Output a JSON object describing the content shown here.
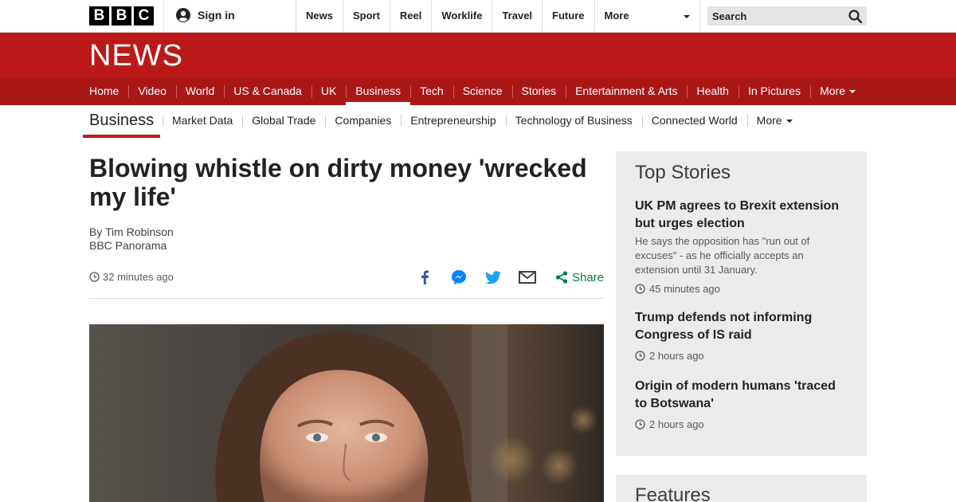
{
  "topbar": {
    "logo_letters": [
      "B",
      "B",
      "C"
    ],
    "signin_label": "Sign in",
    "nav": [
      "News",
      "Sport",
      "Reel",
      "Worklife",
      "Travel",
      "Future"
    ],
    "more_label": "More",
    "search_placeholder": "Search"
  },
  "masthead": {
    "wordmark": "NEWS",
    "sections": [
      {
        "label": "Home"
      },
      {
        "label": "Video"
      },
      {
        "label": "World"
      },
      {
        "label": "US & Canada"
      },
      {
        "label": "UK"
      },
      {
        "label": "Business",
        "active": true
      },
      {
        "label": "Tech"
      },
      {
        "label": "Science"
      },
      {
        "label": "Stories"
      },
      {
        "label": "Entertainment & Arts"
      },
      {
        "label": "Health"
      },
      {
        "label": "In Pictures"
      }
    ],
    "more_label": "More"
  },
  "subnav": {
    "title": "Business",
    "items": [
      "Market Data",
      "Global Trade",
      "Companies",
      "Entrepreneurship",
      "Technology of Business",
      "Connected World"
    ],
    "more_label": "More"
  },
  "article": {
    "headline": "Blowing whistle on dirty money 'wrecked my life'",
    "author": "By Tim Robinson",
    "source": "BBC Panorama",
    "timestamp": "32 minutes ago",
    "share_label": "Share"
  },
  "sidebar": {
    "title": "Top Stories",
    "stories": [
      {
        "headline": "UK PM agrees to Brexit extension but urges election",
        "summary": "He says the opposition has \"run out of excuses\" - as he officially accepts an extension until 31 January.",
        "time": "45 minutes ago"
      },
      {
        "headline": "Trump defends not informing Congress of IS raid",
        "time": "2 hours ago"
      },
      {
        "headline": "Origin of modern humans 'traced to Botswana'",
        "time": "2 hours ago"
      }
    ],
    "features_title": "Features"
  },
  "colors": {
    "brand_red": "#bb1919",
    "nav_red": "#a91717",
    "share_green": "#007f3b",
    "facebook": "#3b5998",
    "messenger": "#0084ff",
    "twitter": "#1da1f2"
  }
}
